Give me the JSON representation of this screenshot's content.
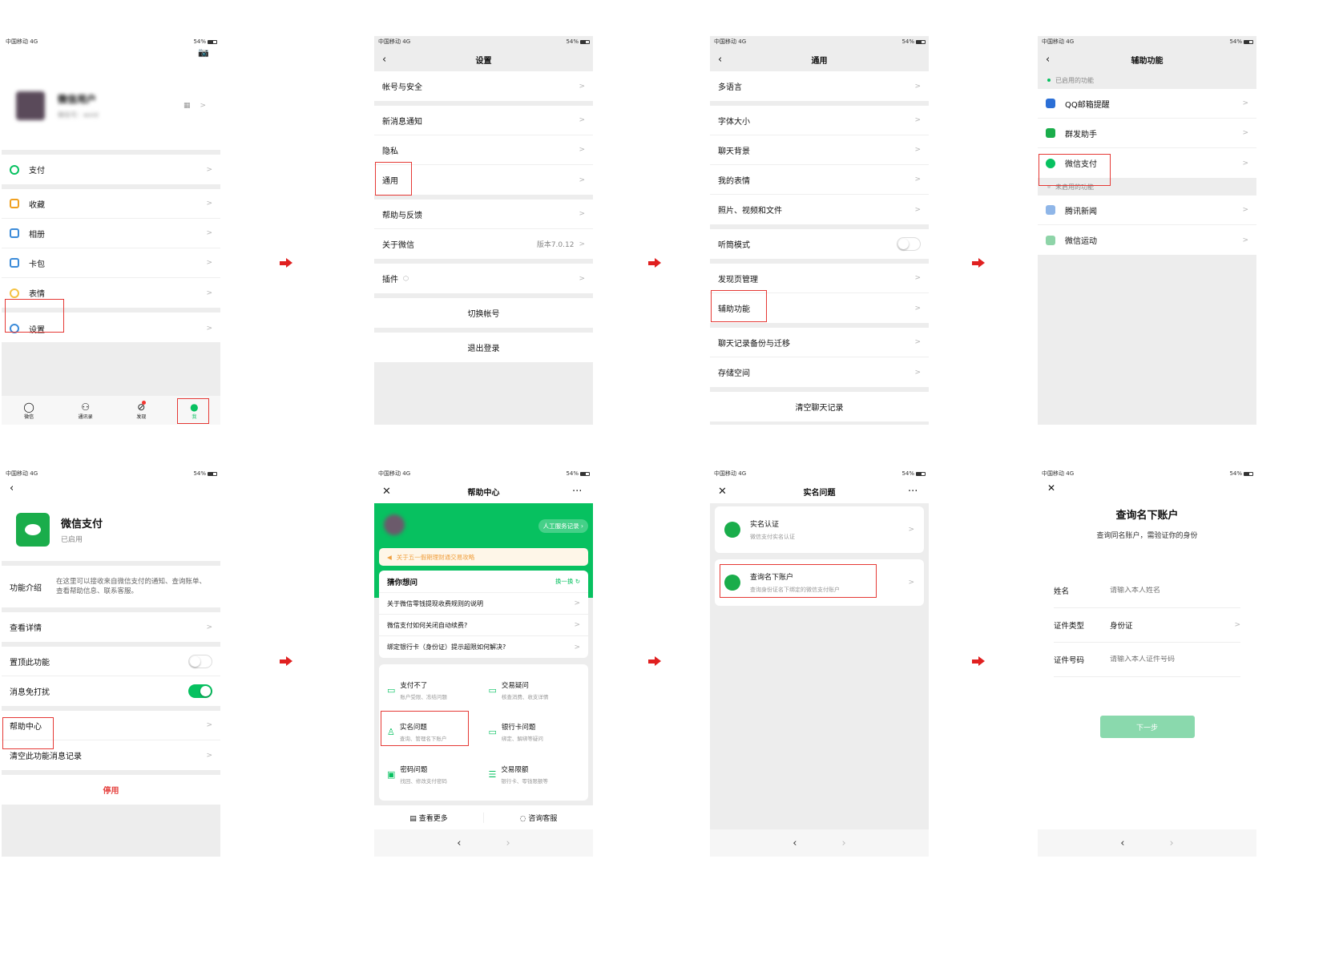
{
  "status": {
    "carrier": "中国移动",
    "network": "4G",
    "battery": "54%"
  },
  "colors": {
    "accent": "#07c160",
    "highlight": "#e53935",
    "arrow": "#e02020",
    "bg": "#ededed"
  },
  "s1": {
    "profile_name": "微信用户",
    "profile_sub": "微信号：wxid",
    "items": [
      {
        "label": "支付",
        "icon": "pay-icon",
        "color": "#07c160"
      },
      {
        "label": "收藏",
        "icon": "favorites-icon",
        "color": "#f0a020"
      },
      {
        "label": "相册",
        "icon": "album-icon",
        "color": "#3b8bd9"
      },
      {
        "label": "卡包",
        "icon": "cards-icon",
        "color": "#3b8bd9"
      },
      {
        "label": "表情",
        "icon": "sticker-icon",
        "color": "#f5c242"
      }
    ],
    "settings": "设置",
    "tabs": [
      "微信",
      "通讯录",
      "发现",
      "我"
    ]
  },
  "s2": {
    "title": "设置",
    "g1": [
      "帐号与安全"
    ],
    "g2": [
      "新消息通知",
      "隐私",
      "通用"
    ],
    "g3": [
      "帮助与反馈",
      "关于微信"
    ],
    "version": "版本7.0.12",
    "g4": [
      "插件"
    ],
    "switch_account": "切换帐号",
    "logout": "退出登录"
  },
  "s3": {
    "title": "通用",
    "g1": [
      "多语言"
    ],
    "g2": [
      "字体大小",
      "聊天背景",
      "我的表情",
      "照片、视频和文件"
    ],
    "g3": [
      "听筒模式"
    ],
    "g4": [
      "发现页管理",
      "辅助功能"
    ],
    "g5": [
      "聊天记录备份与迁移",
      "存储空间"
    ],
    "clear": "清空聊天记录"
  },
  "s4": {
    "title": "辅助功能",
    "enabled": "已启用的功能",
    "enabled_items": [
      {
        "label": "QQ邮箱提醒",
        "icon": "mail-icon",
        "color": "#2b6fd6"
      },
      {
        "label": "群发助手",
        "icon": "broadcast-icon",
        "color": "#1aad4b"
      },
      {
        "label": "微信支付",
        "icon": "wechat-pay-icon",
        "color": "#07c160"
      }
    ],
    "disabled": "未启用的功能",
    "disabled_items": [
      {
        "label": "腾讯新闻",
        "icon": "news-icon",
        "color": "#8fb6e8"
      },
      {
        "label": "微信运动",
        "icon": "sport-icon",
        "color": "#8ed4a8"
      }
    ]
  },
  "s5": {
    "name": "微信支付",
    "status": "已启用",
    "intro_label": "功能介绍",
    "intro_text": "在这里可以接收来自微信支付的通知、查询账单、查看帮助信息、联系客服。",
    "details": "查看详情",
    "pin": "置顶此功能",
    "mute": "消息免打扰",
    "help": "帮助中心",
    "clear": "清空此功能消息记录",
    "disable": "停用"
  },
  "s6": {
    "title": "帮助中心",
    "service": "人工服务记录",
    "notice": "关于五一假期理财通交易攻略",
    "guess": "猜你想问",
    "refresh": "换一换",
    "questions": [
      "关于微信零钱提现收费规则的说明",
      "微信支付如何关闭自动续费?",
      "绑定银行卡（身份证）提示超限如何解决?"
    ],
    "cats": [
      {
        "t": "支付不了",
        "s": "账户受限、冻结问题",
        "icon": "wallet-icon"
      },
      {
        "t": "交易疑问",
        "s": "核查消费、收支详情",
        "icon": "transaction-icon"
      },
      {
        "t": "实名问题",
        "s": "查询、管理名下账户",
        "icon": "user-icon"
      },
      {
        "t": "银行卡问题",
        "s": "绑定、解绑等疑问",
        "icon": "bank-card-icon"
      },
      {
        "t": "密码问题",
        "s": "找回、修改支付密码",
        "icon": "password-icon"
      },
      {
        "t": "交易限额",
        "s": "银行卡、零钱限额等",
        "icon": "limit-icon"
      }
    ],
    "more": "查看更多",
    "consult": "咨询客服"
  },
  "s7": {
    "title": "实名问题",
    "items": [
      {
        "t": "实名认证",
        "s": "微信支付实名认证"
      },
      {
        "t": "查询名下账户",
        "s": "查询身份证名下绑定的微信支付账户"
      }
    ]
  },
  "s8": {
    "title": "查询名下账户",
    "sub": "查询同名账户，需验证你的身份",
    "name_label": "姓名",
    "name_ph": "请输入本人姓名",
    "type_label": "证件类型",
    "type_val": "身份证",
    "id_label": "证件号码",
    "id_ph": "请输入本人证件号码",
    "next": "下一步"
  }
}
